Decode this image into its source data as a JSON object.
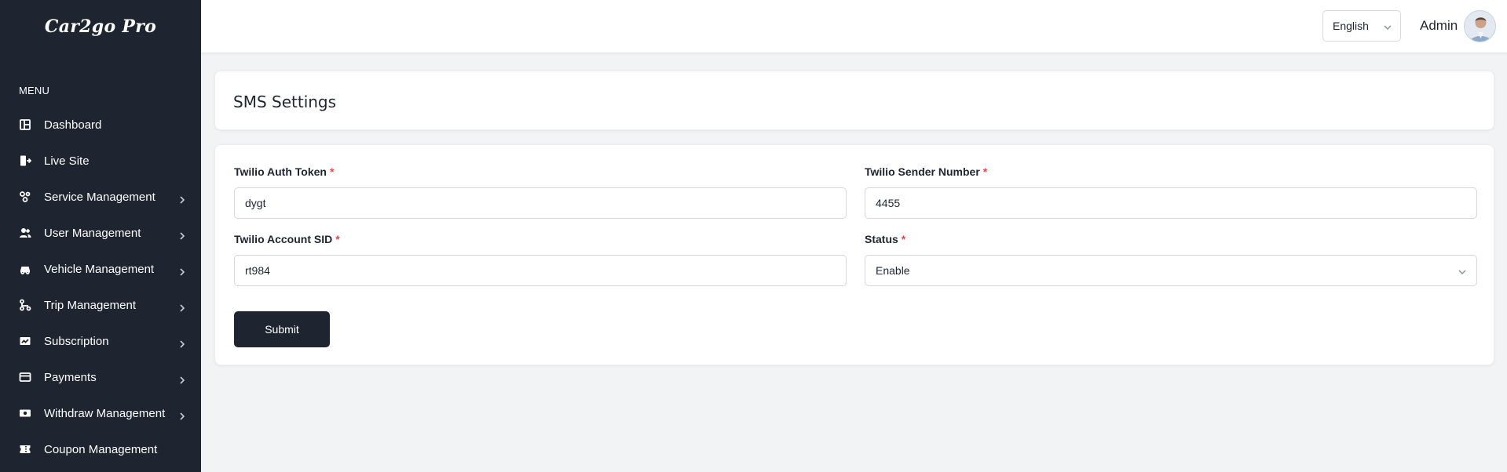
{
  "brand": {
    "name": "Car2go Pro"
  },
  "sidebar": {
    "menu_heading": "MENU",
    "items": [
      {
        "label": "Dashboard",
        "icon": "dashboard-icon",
        "has_submenu": false
      },
      {
        "label": "Live Site",
        "icon": "live-site-icon",
        "has_submenu": false
      },
      {
        "label": "Service Management",
        "icon": "service-icon",
        "has_submenu": true
      },
      {
        "label": "User Management",
        "icon": "users-icon",
        "has_submenu": true
      },
      {
        "label": "Vehicle Management",
        "icon": "car-icon",
        "has_submenu": true
      },
      {
        "label": "Trip Management",
        "icon": "trip-icon",
        "has_submenu": true
      },
      {
        "label": "Subscription",
        "icon": "subscription-icon",
        "has_submenu": true
      },
      {
        "label": "Payments",
        "icon": "card-icon",
        "has_submenu": true
      },
      {
        "label": "Withdraw Management",
        "icon": "cash-icon",
        "has_submenu": true
      },
      {
        "label": "Coupon Management",
        "icon": "coupon-icon",
        "has_submenu": false
      }
    ]
  },
  "header": {
    "language": "English",
    "user_name": "Admin"
  },
  "page": {
    "title": "SMS Settings"
  },
  "form": {
    "auth_token": {
      "label": "Twilio Auth Token",
      "value": "dygt"
    },
    "sender_number": {
      "label": "Twilio Sender Number",
      "value": "4455"
    },
    "account_sid": {
      "label": "Twilio Account SID",
      "value": "rt984"
    },
    "status": {
      "label": "Status",
      "value": "Enable"
    },
    "required_mark": "*",
    "submit_label": "Submit"
  },
  "colors": {
    "sidebar_bg": "#1e2530",
    "page_bg": "#f2f3f5",
    "required": "#e5484d",
    "button_bg": "#1e2530"
  }
}
